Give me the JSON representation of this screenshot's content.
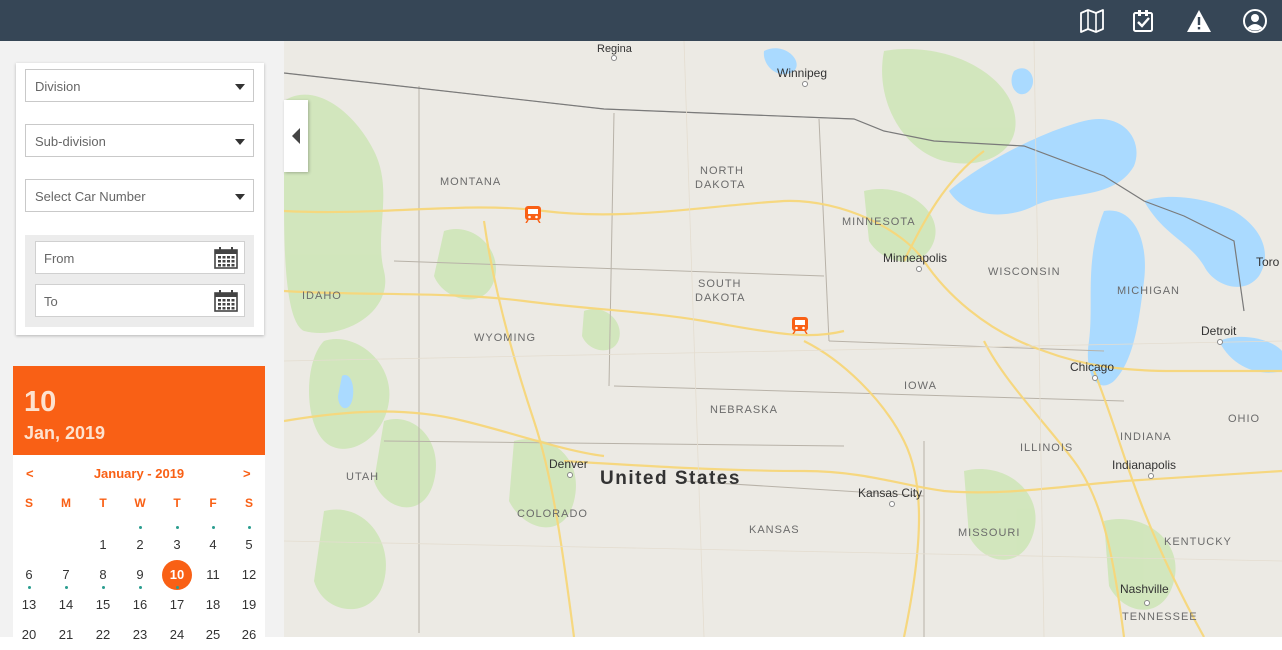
{
  "topbar": {
    "icons": [
      "map-icon",
      "checklist-icon",
      "alert-icon",
      "user-icon"
    ]
  },
  "filters": {
    "division_placeholder": "Division",
    "subdivision_placeholder": "Sub-division",
    "car_number_placeholder": "Select Car Number",
    "from_placeholder": "From",
    "to_placeholder": "To"
  },
  "calendar": {
    "selected_day": "10",
    "selected_month_year": "Jan, 2019",
    "prev_label": "<",
    "next_label": ">",
    "month_label": "January -  2019",
    "weekdays": [
      "S",
      "M",
      "T",
      "W",
      "T",
      "F",
      "S"
    ],
    "rows": [
      [
        "",
        "",
        "1",
        "2",
        "3",
        "4",
        "5"
      ],
      [
        "6",
        "7",
        "8",
        "9",
        "10",
        "11",
        "12"
      ],
      [
        "13",
        "14",
        "15",
        "16",
        "17",
        "18",
        "19"
      ],
      [
        "20",
        "21",
        "22",
        "23",
        "24",
        "25",
        "26"
      ]
    ]
  },
  "map": {
    "country_label": "United States",
    "regions": {
      "montana": "MONTANA",
      "north_dakota_1": "NORTH",
      "north_dakota_2": "DAKOTA",
      "minnesota": "MINNESOTA",
      "wisconsin": "WISCONSIN",
      "michigan": "MICHIGAN",
      "idaho": "IDAHO",
      "wyoming": "WYOMING",
      "south_dakota_1": "SOUTH",
      "south_dakota_2": "DAKOTA",
      "iowa": "IOWA",
      "nebraska": "NEBRASKA",
      "illinois": "ILLINOIS",
      "indiana": "INDIANA",
      "ohio": "OHIO",
      "utah": "UTAH",
      "colorado": "COLORADO",
      "kansas": "KANSAS",
      "missouri": "MISSOURI",
      "kentucky": "KENTUCKY",
      "tennessee": "TENNESSEE"
    },
    "cities": {
      "regina": "Regina",
      "winnipeg": "Winnipeg",
      "minneapolis": "Minneapolis",
      "detroit": "Detroit",
      "toronto": "Toro",
      "chicago": "Chicago",
      "indianapolis": "Indianapolis",
      "denver": "Denver",
      "kansas_city": "Kansas City",
      "nashville": "Nashville"
    },
    "colors": {
      "land": "#eceae4",
      "water": "#aadaff",
      "park": "#cfe6b8",
      "road": "#f7d77a",
      "marker": "#f96015"
    }
  }
}
